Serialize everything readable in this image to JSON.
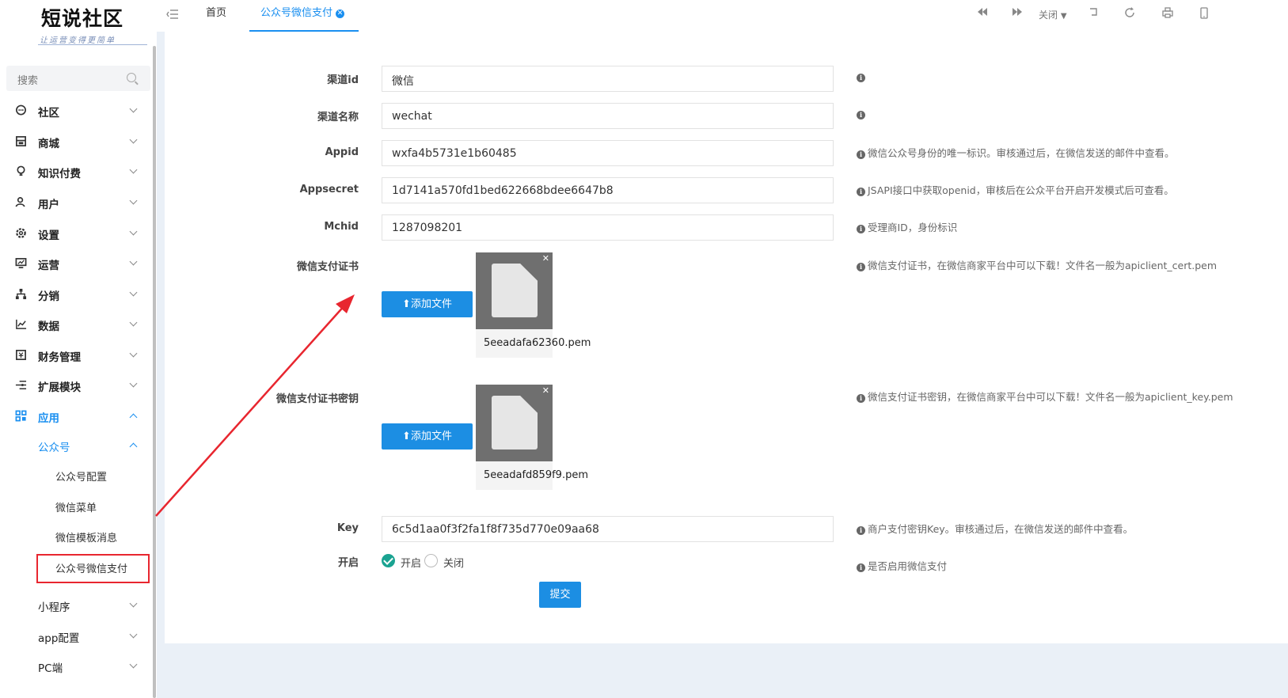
{
  "logo": {
    "title": "短说社区",
    "subtitle": "让运营变得更简单"
  },
  "search": {
    "placeholder": "搜索"
  },
  "sidebar": {
    "items": [
      {
        "label": "社区",
        "icon": "chat-icon"
      },
      {
        "label": "商城",
        "icon": "shop-icon"
      },
      {
        "label": "知识付费",
        "icon": "bulb-icon"
      },
      {
        "label": "用户",
        "icon": "user-icon"
      },
      {
        "label": "设置",
        "icon": "gear-icon"
      },
      {
        "label": "运营",
        "icon": "monitor-icon"
      },
      {
        "label": "分销",
        "icon": "network-icon"
      },
      {
        "label": "数据",
        "icon": "chart-icon"
      },
      {
        "label": "财务管理",
        "icon": "finance-icon"
      },
      {
        "label": "扩展模块",
        "icon": "extend-icon"
      },
      {
        "label": "应用",
        "icon": "grid-icon"
      }
    ],
    "sub_group": {
      "label": "公众号"
    },
    "sub_items": [
      "公众号配置",
      "微信菜单",
      "微信模板消息",
      "公众号微信支付"
    ],
    "more_items": [
      "小程序",
      "app配置",
      "PC端"
    ]
  },
  "topbar": {
    "tabs": {
      "home": "首页",
      "active": "公众号微信支付"
    },
    "close_label": "关闭"
  },
  "form": {
    "channel_id": {
      "label": "渠道id",
      "value": "微信"
    },
    "channel_name": {
      "label": "渠道名称",
      "value": "wechat"
    },
    "appid": {
      "label": "Appid",
      "value": "wxfa4b5731e1b60485",
      "hint": "微信公众号身份的唯一标识。审核通过后，在微信发送的邮件中查看。"
    },
    "appsecret": {
      "label": "Appsecret",
      "value": "1d7141a570fd1bed622668bdee6647b8",
      "hint": "JSAPI接口中获取openid，审核后在公众平台开启开发模式后可查看。"
    },
    "mchid": {
      "label": "Mchid",
      "value": "1287098201",
      "hint": "受理商ID，身份标识"
    },
    "cert": {
      "label": "微信支付证书",
      "button": "添加文件",
      "file": "5eeadafa62360.pem",
      "hint": "微信支付证书，在微信商家平台中可以下载！文件名一般为apiclient_cert.pem"
    },
    "cert_key": {
      "label": "微信支付证书密钥",
      "button": "添加文件",
      "file": "5eeadafd859f9.pem",
      "hint": "微信支付证书密钥，在微信商家平台中可以下载！文件名一般为apiclient_key.pem"
    },
    "key": {
      "label": "Key",
      "value": "6c5d1aa0f3f2fa1f8f735d770e09aa68",
      "hint": "商户支付密钥Key。审核通过后，在微信发送的邮件中查看。"
    },
    "enable": {
      "label": "开启",
      "on": "开启",
      "off": "关闭",
      "selected": "开启",
      "hint": "是否启用微信支付"
    },
    "submit": "提交"
  },
  "colors": {
    "accent": "#1a8ff0",
    "annotation": "#e8262f",
    "check": "#1aa391"
  }
}
